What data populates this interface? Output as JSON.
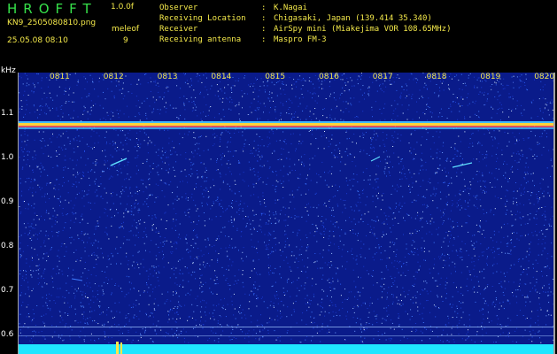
{
  "header": {
    "logo": "HROFFT",
    "version": "1.0.0f",
    "filename": "KN9_2505080810.png",
    "station": "meleof",
    "datetime": "25.05.08 08:10",
    "count": "9"
  },
  "info": [
    {
      "label": "Observer",
      "value": "K.Nagai"
    },
    {
      "label": "Receiving Location",
      "value": "Chigasaki, Japan (139.414 35.340)"
    },
    {
      "label": "Receiver",
      "value": "AirSpy mini (Miakejima VOR 108.65MHz)"
    },
    {
      "label": "Receiving antenna",
      "value": "Maspro FM-3"
    }
  ],
  "colors": {
    "background": "#000000",
    "plot": "#0a1b8a",
    "header_text": "#f3e84a",
    "logo": "#36e14a",
    "axis_label": "#ffffff"
  },
  "chart_data": {
    "type": "heatmap",
    "ylabel": "kHz",
    "y_ticks": [
      "1.1",
      "1.0",
      "0.9",
      "0.8",
      "0.7",
      "0.6"
    ],
    "x_ticks": [
      "0811",
      "0812",
      "0813",
      "0814",
      "0815",
      "0816",
      "0817",
      "0818",
      "0819",
      "0820"
    ],
    "strong_band_khz": 1.07
  }
}
